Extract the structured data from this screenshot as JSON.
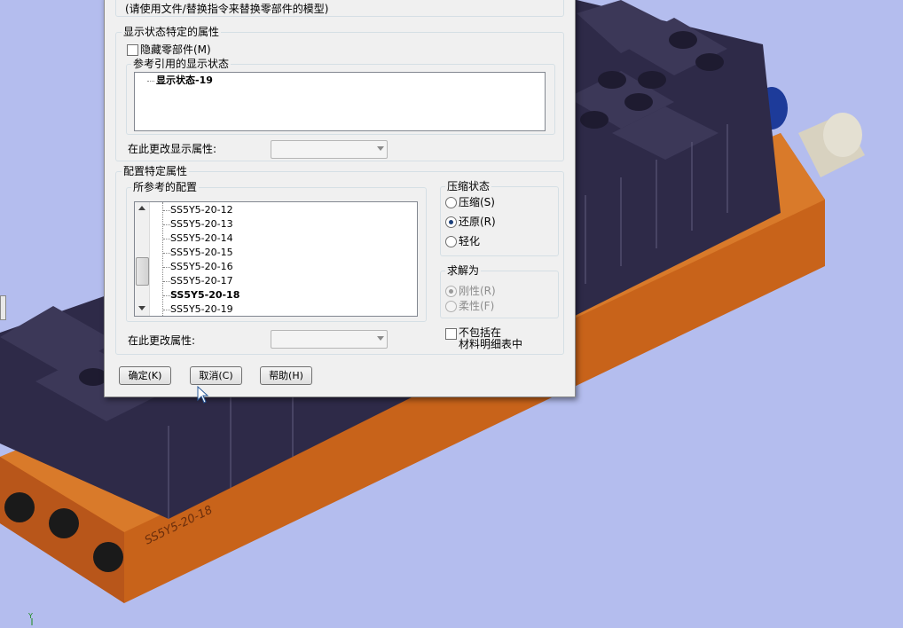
{
  "dialog": {
    "instruction": "(请使用文件/替换指令来替换零部件的模型)",
    "display_state_group": {
      "title": "显示状态特定的属性",
      "hide_component_label": "隐藏零部件(M)",
      "ref_display_group_title": "参考引用的显示状态",
      "display_states": [
        "显示状态-19"
      ],
      "change_display_label": "在此更改显示属性:"
    },
    "config_group": {
      "title": "配置特定属性",
      "referenced_config_title": "所参考的配置",
      "configs": [
        "SS5Y5-20-12",
        "SS5Y5-20-13",
        "SS5Y5-20-14",
        "SS5Y5-20-15",
        "SS5Y5-20-16",
        "SS5Y5-20-17",
        "SS5Y5-20-18",
        "SS5Y5-20-19"
      ],
      "selected_config": "SS5Y5-20-18",
      "change_property_label": "在此更改属性:"
    },
    "suppression": {
      "title": "压缩状态",
      "options": [
        "压缩(S)",
        "还原(R)",
        "轻化"
      ],
      "selected": "还原(R)"
    },
    "solve_as": {
      "title": "求解为",
      "options": [
        "刚性(R)",
        "柔性(F)"
      ],
      "selected": "刚性(R)"
    },
    "exclude_bom_label_line1": "不包括在",
    "exclude_bom_label_line2": "材料明细表中",
    "buttons": {
      "ok": "确定(K)",
      "cancel": "取消(C)",
      "help": "帮助(H)"
    }
  },
  "model": {
    "part_engraving": "SS5Y5-20-18",
    "axis_label": "Y"
  },
  "colors": {
    "background": "#b4bdee",
    "manifold": "#c8631a",
    "valve": "#2e2a48"
  }
}
